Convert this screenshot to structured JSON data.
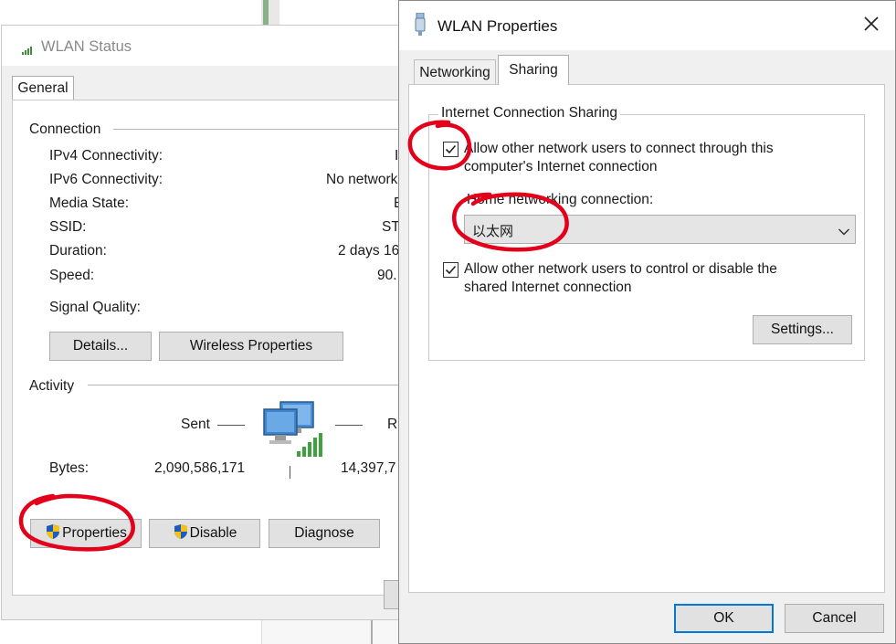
{
  "status_window": {
    "title": "WLAN Status",
    "tab_general": "General",
    "connection_heading": "Connection",
    "rows": [
      {
        "label": "IPv4 Connectivity:",
        "value": "I"
      },
      {
        "label": "IPv6 Connectivity:",
        "value": "No network"
      },
      {
        "label": "Media State:",
        "value": "E"
      },
      {
        "label": "SSID:",
        "value": "ST"
      },
      {
        "label": "Duration:",
        "value": "2 days 16"
      },
      {
        "label": "Speed:",
        "value": "90."
      }
    ],
    "signal_quality_label": "Signal Quality:",
    "details_button": "Details...",
    "wireless_properties_button": "Wireless Properties",
    "activity_heading": "Activity",
    "sent_label": "Sent",
    "received_label": "Re",
    "bytes_label": "Bytes:",
    "bytes_sent": "2,090,586,171",
    "bytes_received": "14,397,7",
    "properties_button": "Properties",
    "disable_button": "Disable",
    "diagnose_button": "Diagnose"
  },
  "props_window": {
    "title": "WLAN Properties",
    "tabs": [
      {
        "label": "Networking"
      },
      {
        "label": "Sharing"
      }
    ],
    "group_title": "Internet Connection Sharing",
    "allow_connect_line1": "Allow other network users to connect through this",
    "allow_connect_line2": "computer's Internet connection",
    "allow_connect_checked": true,
    "home_networking_label": "Home networking connection:",
    "home_networking_value": "以太网",
    "allow_control_line1": "Allow other network users to control or disable the",
    "allow_control_line2": "shared Internet connection",
    "allow_control_checked": true,
    "settings_button": "Settings...",
    "ok_button": "OK",
    "cancel_button": "Cancel"
  },
  "colors": {
    "accent": "#0078d7",
    "annotation_red": "#e3001b"
  }
}
